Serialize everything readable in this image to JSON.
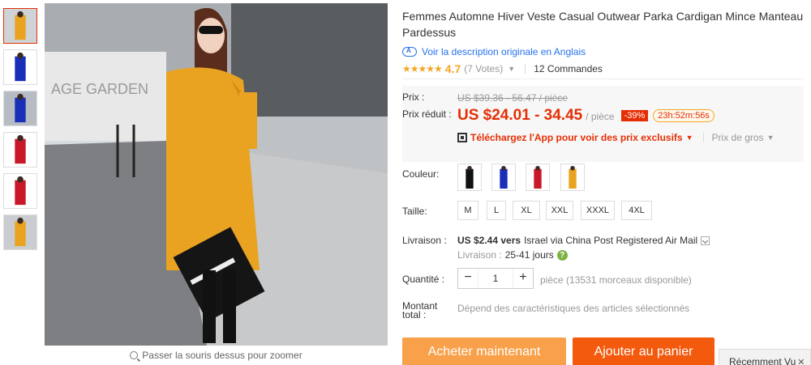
{
  "product": {
    "title": "Femmes Automne Hiver Veste Casual Outwear Parka Cardigan Mince Manteau Pardessus",
    "original_desc_link": "Voir la description originale en Anglais",
    "rating": {
      "score": "4.7",
      "stars": "★★★★★",
      "votes": "(7 Votes)",
      "orders": "12 Commandes"
    }
  },
  "pricing": {
    "price_label": "Prix :",
    "old_price": "US $39.36 - 56.47 / pièce",
    "reduced_label": "Prix réduit :",
    "price": "US $24.01 - 34.45",
    "unit": "/ pièce",
    "discount": "-39%",
    "timer": "23h:52m:56s",
    "app_promo": "Téléchargez l'App pour voir des prix exclusifs",
    "wholesale": "Prix de gros"
  },
  "options": {
    "color_label": "Couleur:",
    "colors": [
      "#111111",
      "#1a2fb8",
      "#c8182a",
      "#e9a321"
    ],
    "size_label": "Taille:",
    "sizes": [
      "M",
      "L",
      "XL",
      "XXL",
      "XXXL",
      "4XL"
    ]
  },
  "shipping": {
    "label": "Livraison :",
    "cost": "US $2.44 vers",
    "destination": "Israel via China Post Registered Air Mail",
    "delivery_label": "Livraison :",
    "days": "25-41 jours"
  },
  "quantity": {
    "label": "Quantité :",
    "value": "1",
    "minus": "−",
    "plus": "+",
    "available": "pièce (13531 morceaux disponible)"
  },
  "total": {
    "label_line1": "Montant",
    "label_line2": "total :",
    "value": "Dépend des caractéristiques des articles sélectionnés"
  },
  "actions": {
    "buy_now": "Acheter maintenant",
    "add_to_cart": "Ajouter au panier"
  },
  "gallery": {
    "zoom_hint": "Passer la souris dessus pour zoomer",
    "thumb_colors": [
      "#e9a321",
      "#1a2fb8",
      "#1a2fb8",
      "#c8182a",
      "#c8182a",
      "#e9a321"
    ],
    "storefront_sign": "AGE GARDEN"
  },
  "recently_viewed": {
    "label": "Récemment Vu",
    "close": "✕"
  },
  "colors": {
    "accent_red": "#e62e04",
    "star": "#f5a623",
    "link": "#2672ec",
    "buy_button": "#f8a14a",
    "cart_button": "#f35a0e"
  }
}
